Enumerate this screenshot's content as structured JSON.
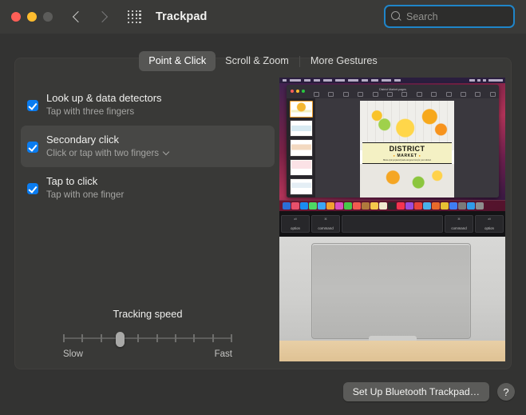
{
  "window": {
    "title": "Trackpad",
    "traffic_lights": [
      {
        "name": "close",
        "color": "#ff5f57"
      },
      {
        "name": "minimize",
        "color": "#febc2e"
      },
      {
        "name": "zoom",
        "color": "#5c5c5a"
      }
    ],
    "back_icon": "chevron-left-icon",
    "forward_icon": "chevron-right-icon",
    "grid_icon": "show-all-grid-icon"
  },
  "search": {
    "placeholder": "Search",
    "value": "",
    "icon": "search-icon",
    "focus_ring_color": "#1f85c9"
  },
  "tabs": [
    {
      "label": "Point & Click",
      "selected": true
    },
    {
      "label": "Scroll & Zoom",
      "selected": false
    },
    {
      "label": "More Gestures",
      "selected": false
    }
  ],
  "options": [
    {
      "title": "Look up & data detectors",
      "subtitle": "Tap with three fingers",
      "checked": true,
      "highlighted": false,
      "has_popup": false
    },
    {
      "title": "Secondary click",
      "subtitle": "Click or tap with two fingers",
      "checked": true,
      "highlighted": true,
      "has_popup": true
    },
    {
      "title": "Tap to click",
      "subtitle": "Tap with one finger",
      "checked": true,
      "highlighted": false,
      "has_popup": false
    }
  ],
  "slider": {
    "title": "Tracking speed",
    "min_label": "Slow",
    "max_label": "Fast",
    "ticks": 10,
    "value_index": 3,
    "accent_color": "#a9a9a7"
  },
  "illustration": {
    "name": "macbook-trackpad-photo",
    "app_window_title": "District Market.pages",
    "document": {
      "headline": "DISTRICT",
      "subhead": "MARKET",
      "tagline": "Home-style prepared foods and groceries for your kitchen",
      "thumbnail_count": 5,
      "selected_thumbnail": 1
    },
    "keys": [
      {
        "top": "alt",
        "label": "option"
      },
      {
        "top": "⌘",
        "label": "command"
      },
      {
        "top": "",
        "label": ""
      },
      {
        "top": "⌘",
        "label": "command"
      },
      {
        "top": "alt",
        "label": "option"
      }
    ],
    "dock_icon_colors": [
      "#2c6fd6",
      "#e8506b",
      "#1a8cf0",
      "#4cd964",
      "#3aa6f5",
      "#f0a030",
      "#d94ec0",
      "#46c94a",
      "#f25b50",
      "#b07a3c",
      "#f5c84b",
      "#f0ead0",
      "#2b2b2b",
      "#f5344f",
      "#9b4ddb",
      "#e8453c",
      "#4ab0e8",
      "#e96a2a",
      "#e8c033",
      "#3f7ef2",
      "#7a7a7a",
      "#2f9be8",
      "#8e8e8e"
    ]
  },
  "footer": {
    "setup_button": "Set Up Bluetooth Trackpad…",
    "help_button": "?"
  }
}
